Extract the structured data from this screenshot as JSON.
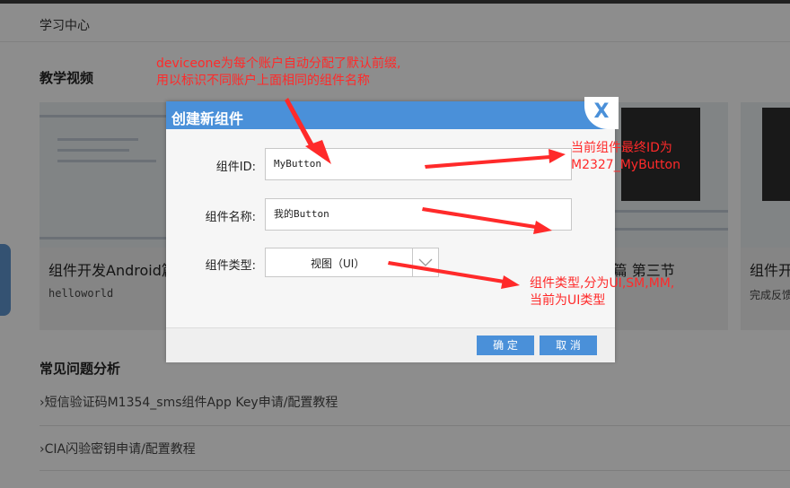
{
  "page": {
    "breadcrumb": "学习中心",
    "video_section": "教学视频",
    "faq_section": "常见问题分析",
    "cards": [
      {
        "title": "组件开发Android篇",
        "subtitle": "helloworld"
      },
      {
        "title": "id篇  第三节",
        "subtitle": ""
      },
      {
        "title": "组件开",
        "subtitle": "完成反馈"
      }
    ],
    "faq": [
      "›短信验证码M1354_sms组件App Key申请/配置教程",
      "›CIA闪验密钥申请/配置教程"
    ]
  },
  "dialog": {
    "title": "创建新组件",
    "close_glyph": "X",
    "id_label": "组件ID:",
    "id_value": "MyButton",
    "name_label": "组件名称:",
    "name_value": "我的Button",
    "type_label": "组件类型:",
    "type_value": "视图（UI）",
    "ok_label": "确 定",
    "cancel_label": "取 消"
  },
  "annotations": {
    "top": [
      "deviceone为每个账户自动分配了默认前缀,",
      "用以标识不同账户上面相同的组件名称"
    ],
    "id": [
      "当前组件最终ID为",
      "M2327_MyButton"
    ],
    "type": [
      "组件类型,分为UI,SM,MM,",
      "当前为UI类型"
    ]
  },
  "colors": {
    "accent": "#4a90d9",
    "annotation": "#ff2a2a"
  }
}
